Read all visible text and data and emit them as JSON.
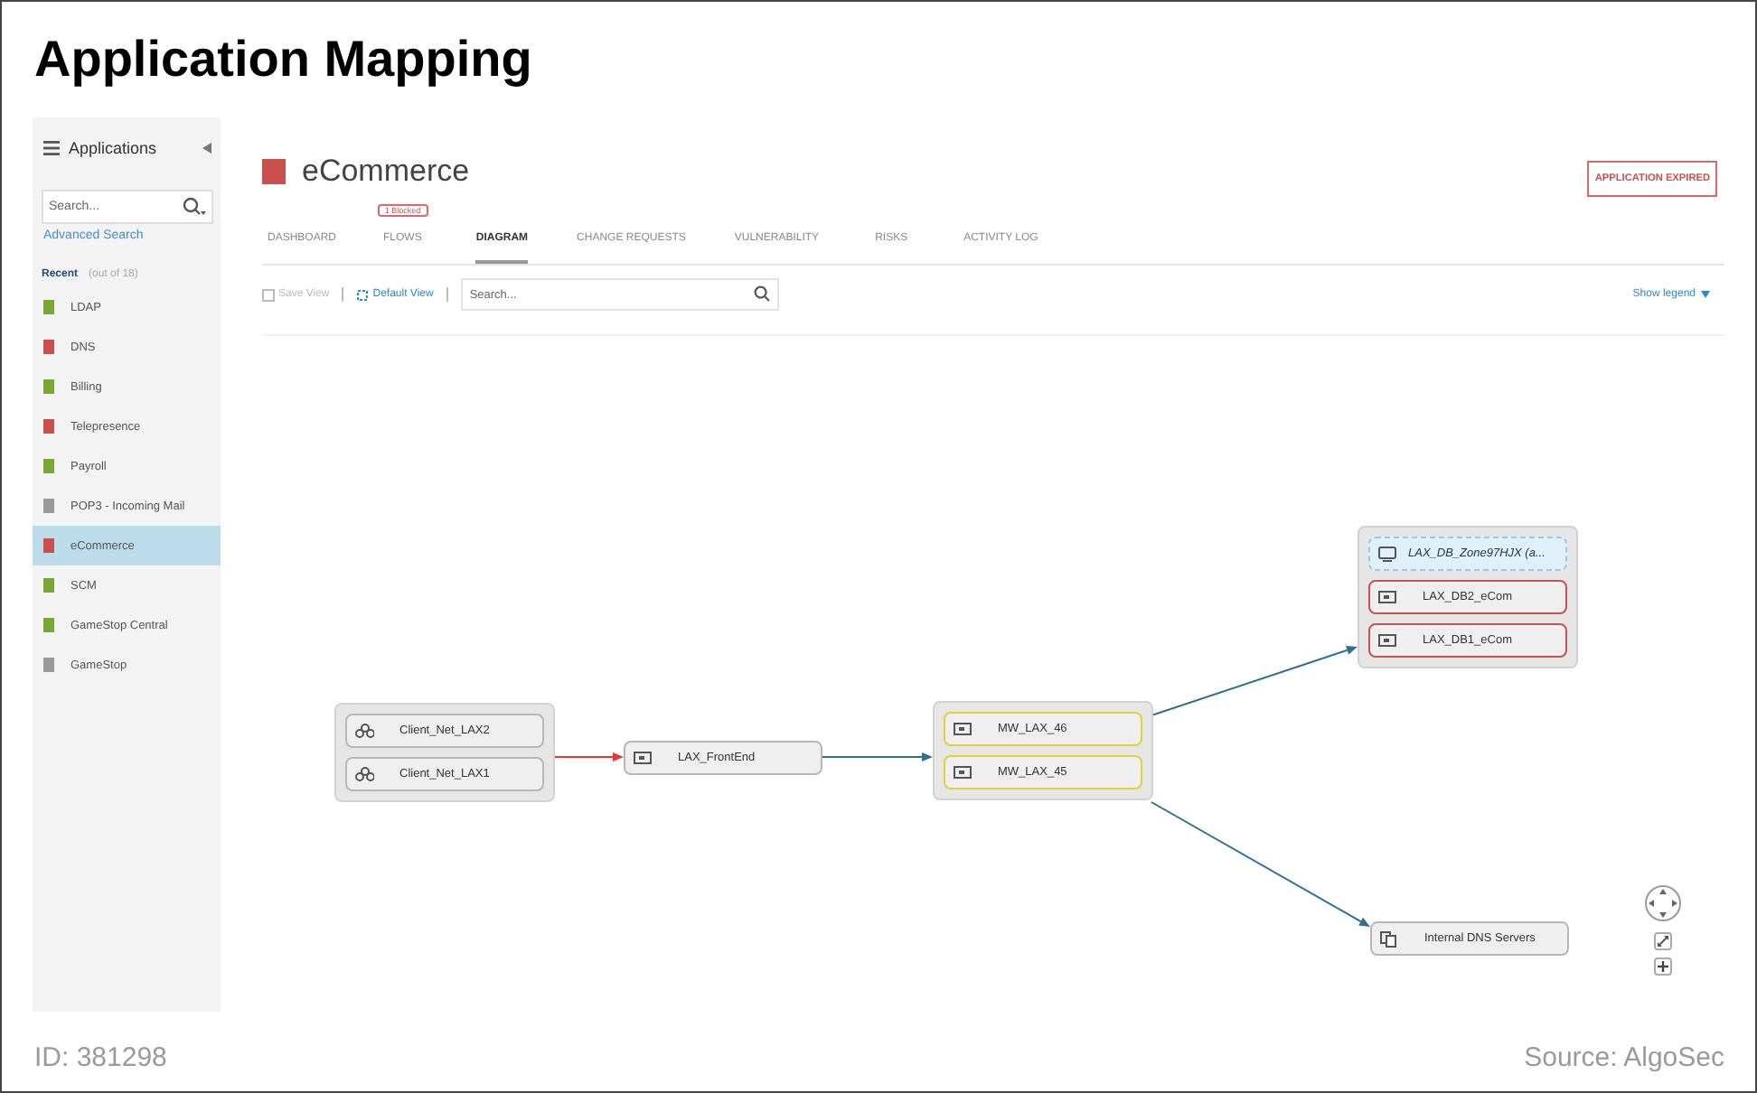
{
  "title": "Application Mapping",
  "sidebar": {
    "title": "Applications",
    "search": {
      "placeholder": "Search..."
    },
    "advanced_search": "Advanced Search",
    "recent_label": "Recent",
    "recent_count": "(out of 18)",
    "items": [
      {
        "label": "LDAP",
        "color": "#7aa632",
        "selected": false
      },
      {
        "label": "DNS",
        "color": "#c9504d",
        "selected": false
      },
      {
        "label": "Billing",
        "color": "#7aa632",
        "selected": false
      },
      {
        "label": "Telepresence",
        "color": "#c9504d",
        "selected": false
      },
      {
        "label": "Payroll",
        "color": "#7aa632",
        "selected": false
      },
      {
        "label": "POP3 - Incoming Mail",
        "color": "#9a9a9a",
        "selected": false
      },
      {
        "label": "eCommerce",
        "color": "#c9504d",
        "selected": true
      },
      {
        "label": "SCM",
        "color": "#7aa632",
        "selected": false
      },
      {
        "label": "GameStop Central",
        "color": "#7aa632",
        "selected": false
      },
      {
        "label": "GameStop",
        "color": "#9a9a9a",
        "selected": false
      }
    ]
  },
  "app": {
    "name": "eCommerce",
    "color": "#c9504d",
    "status_badge": "APPLICATION EXPIRED"
  },
  "tabs": [
    {
      "label": "DASHBOARD",
      "selected": false
    },
    {
      "label": "FLOWS",
      "selected": false,
      "badge": "1 Blocked"
    },
    {
      "label": "DIAGRAM",
      "selected": true
    },
    {
      "label": "CHANGE REQUESTS",
      "selected": false
    },
    {
      "label": "VULNERABILITY",
      "selected": false
    },
    {
      "label": "RISKS",
      "selected": false
    },
    {
      "label": "ACTIVITY LOG",
      "selected": false
    }
  ],
  "toolbar": {
    "save_view": {
      "label": "Save View",
      "disabled": true
    },
    "default_view": {
      "label": "Default View",
      "disabled": false
    },
    "search": {
      "placeholder": "Search..."
    },
    "show_legend": "Show legend"
  },
  "diagram": {
    "groups": [
      {
        "nodes": [
          {
            "label": "Client_Net_LAX2",
            "kind": "network",
            "color": "#b7b7b7"
          },
          {
            "label": "Client_Net_LAX1",
            "kind": "network",
            "color": "#b7b7b7"
          }
        ]
      },
      {
        "nodes": [
          {
            "label": "LAX_FrontEnd",
            "kind": "server",
            "color": "#b7b7b7"
          }
        ]
      },
      {
        "nodes": [
          {
            "label": "MW_LAX_46",
            "kind": "server",
            "color": "#e4cf3b"
          },
          {
            "label": "MW_LAX_45",
            "kind": "server",
            "color": "#e4cf3b"
          }
        ]
      },
      {
        "nodes": [
          {
            "label": "LAX_DB_Zone97HJX (a...",
            "kind": "zone",
            "color": "#9fc6dd"
          },
          {
            "label": "LAX_DB2_eCom",
            "kind": "server",
            "color": "#c9504d"
          },
          {
            "label": "LAX_DB1_eCom",
            "kind": "server",
            "color": "#c9504d"
          }
        ]
      },
      {
        "nodes": [
          {
            "label": "Internal DNS Servers",
            "kind": "dns",
            "color": "#b7b7b7"
          }
        ]
      }
    ],
    "connections": [
      {
        "color": "#e23a3a"
      },
      {
        "color": "#2f6f8f"
      },
      {
        "color": "#2f6f8f"
      },
      {
        "color": "#2f6f8f"
      }
    ]
  },
  "footer": {
    "id": "ID: 381298",
    "source": "Source: AlgoSec"
  }
}
